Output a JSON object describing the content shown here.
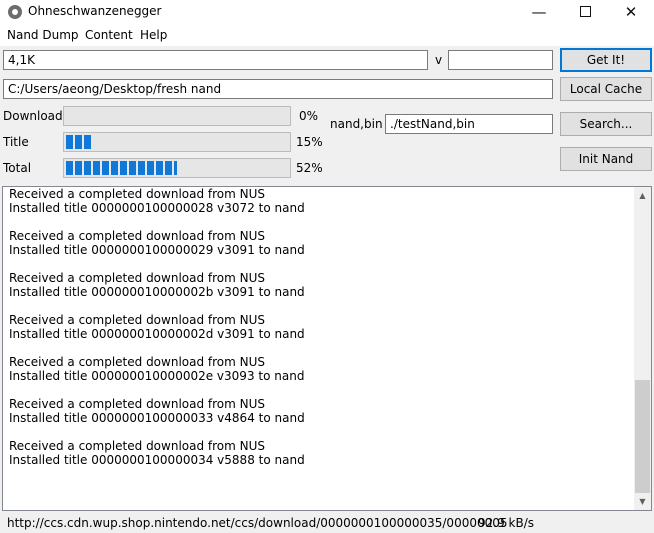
{
  "window": {
    "title": "Ohneschwanzenegger",
    "minimize": "—",
    "close": "✕"
  },
  "menu": [
    "Nand Dump",
    "Content",
    "Help"
  ],
  "form": {
    "size_value": "4,1K",
    "version_label": "v",
    "version_value": "",
    "get_it_button": "Get It!",
    "path_value": "C:/Users/aeong/Desktop/fresh nand",
    "local_cache_button": "Local Cache",
    "nand_bin_label": "nand,bin",
    "nand_bin_value": "./testNand,bin",
    "search_button": "Search...",
    "init_nand_button": "Init Nand"
  },
  "progress": [
    {
      "label": "Download",
      "percent_text": "0%",
      "value": 0
    },
    {
      "label": "Title",
      "percent_text": "15%",
      "value": 0.12
    },
    {
      "label": "Total",
      "percent_text": "52%",
      "value": 0.5
    }
  ],
  "log": [
    "Received a completed download from NUS",
    "Installed title 0000000100000028 v3072 to nand",
    "",
    "Received a completed download from NUS",
    "Installed title 0000000100000029 v3091 to nand",
    "",
    "Received a completed download from NUS",
    "Installed title 000000010000002b v3091 to nand",
    "",
    "Received a completed download from NUS",
    "Installed title 000000010000002d v3091 to nand",
    "",
    "Received a completed download from NUS",
    "Installed title 000000010000002e v3093 to nand",
    "",
    "Received a completed download from NUS",
    "Installed title 0000000100000033 v4864 to nand",
    "",
    "Received a completed download from NUS",
    "Installed title 0000000100000034 v5888 to nand"
  ],
  "status": {
    "url": "http://ccs.cdn.wup.shop.nintendo.net/ccs/download/0000000100000035/00000005",
    "speed": "92.9 kB/s"
  },
  "colors": {
    "progress_fill": "#0f78d8",
    "default_button_border": "#0078d7"
  }
}
